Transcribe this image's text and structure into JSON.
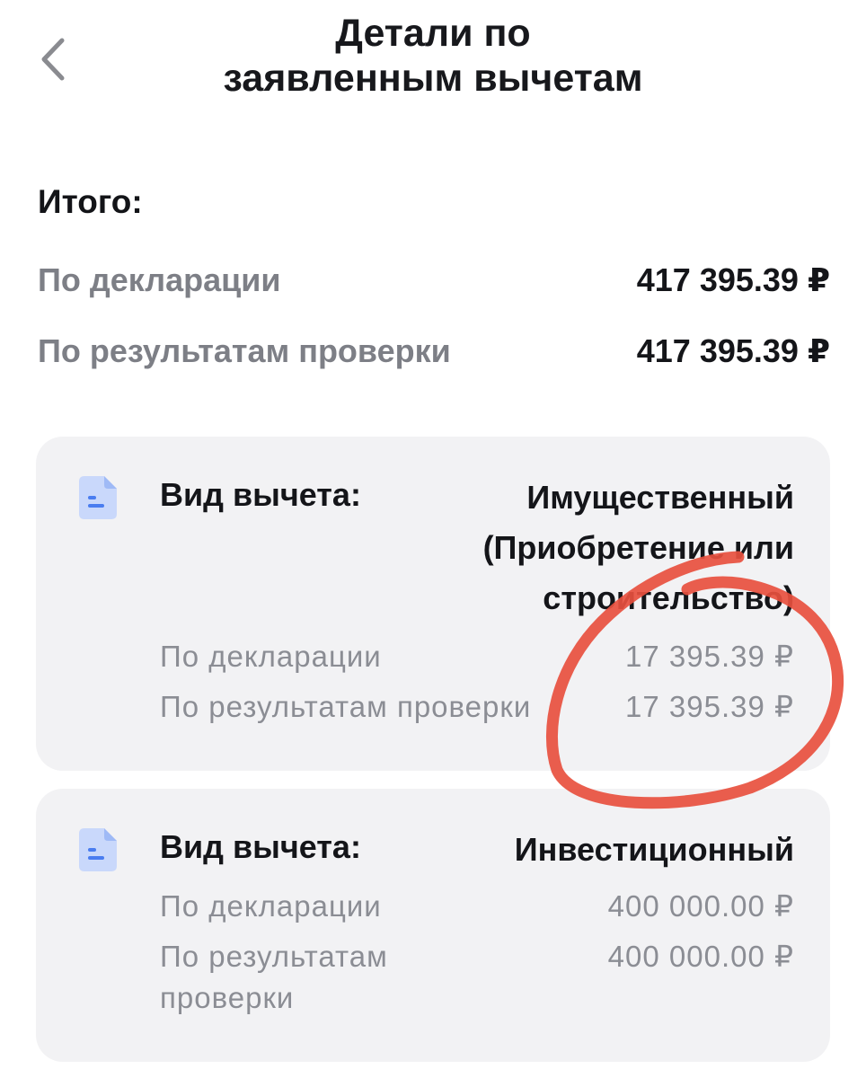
{
  "header": {
    "title_line1": "Детали по",
    "title_line2": "заявленным вычетам"
  },
  "totals": {
    "heading": "Итого:",
    "rows": [
      {
        "label": "По декларации",
        "value": "417 395.39 ₽"
      },
      {
        "label": "По результатам проверки",
        "value": "417 395.39 ₽"
      }
    ]
  },
  "deductions": [
    {
      "kind_label": "Вид вычета:",
      "kind_value_lines": [
        "Имущественный",
        "(Приобретение или",
        "строительство)"
      ],
      "rows": [
        {
          "label": "По декларации",
          "value": "17 395.39 ₽"
        },
        {
          "label": "По результатам проверки",
          "value": "17 395.39 ₽"
        }
      ]
    },
    {
      "kind_label": "Вид вычета:",
      "kind_value_lines": [
        "Инвестиционный"
      ],
      "rows": [
        {
          "label": "По декларации",
          "value": "400 000.00 ₽"
        },
        {
          "label": "По результатам проверки",
          "value": "400 000.00 ₽"
        }
      ]
    }
  ],
  "colors": {
    "accent_icon": "#4a7df0",
    "icon_background": "#c9d8fb",
    "annotation_stroke": "#e8503e",
    "card_background": "#f2f2f4"
  },
  "icons": {
    "back": "chevron-left-icon",
    "deduction": "document-icon"
  }
}
